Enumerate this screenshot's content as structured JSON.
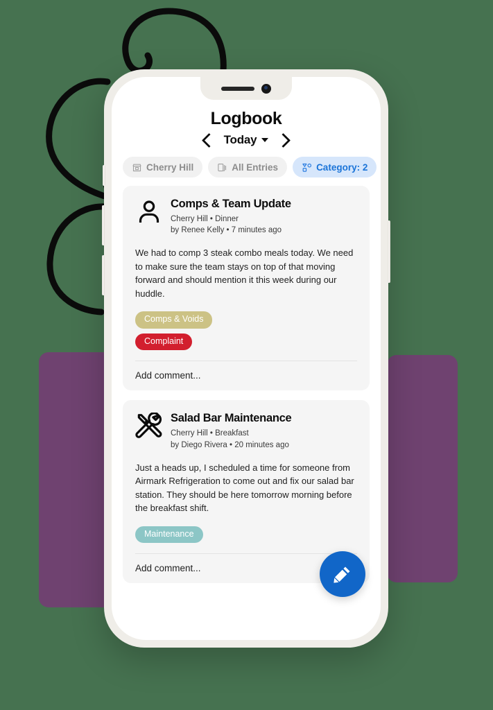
{
  "theme": {
    "background": "#467250",
    "purple_block": "#6F4270",
    "phone_frame": "#EFEDE8",
    "screen": "#FFFFFF",
    "accent_blue": "#1166C8",
    "chip_active_bg": "#D6E6FB",
    "chip_active_text": "#1B74D8",
    "card_bg": "#F5F5F5"
  },
  "app": {
    "title": "Logbook",
    "date_nav": {
      "prev_icon": "chevron-left-icon",
      "label": "Today",
      "caret_icon": "caret-down-icon",
      "next_icon": "chevron-right-icon"
    },
    "filters": [
      {
        "label": "Cherry Hill",
        "icon": "store-icon",
        "active": false
      },
      {
        "label": "All Entries",
        "icon": "documents-icon",
        "active": false
      },
      {
        "label": "Category: 2",
        "icon": "shapes-filter-icon",
        "active": true
      }
    ],
    "entries": [
      {
        "icon": "person-icon",
        "title": "Comps & Team Update",
        "location_shift": "Cherry Hill • Dinner",
        "author_time": "by Renee Kelly • 7 minutes ago",
        "body": "We had to comp 3 steak combo meals today. We need to make sure the team stays on top of that moving forward and should mention it this week during our huddle.",
        "tags": [
          {
            "label": "Comps & Voids",
            "color": "#CCC285"
          },
          {
            "label": "Complaint",
            "color": "#D21F2E"
          }
        ],
        "comment_placeholder": "Add comment..."
      },
      {
        "icon": "tools-icon",
        "title": "Salad Bar Maintenance",
        "location_shift": "Cherry Hill • Breakfast",
        "author_time": "by Diego Rivera • 20 minutes ago",
        "body": "Just a heads up, I scheduled a time for someone from Airmark Refrigeration to come out and fix our salad bar station. They should be here tomorrow morning before the breakfast shift.",
        "tags": [
          {
            "label": "Maintenance",
            "color": "#8CC6C6"
          }
        ],
        "comment_placeholder": "Add comment..."
      }
    ],
    "fab": {
      "icon": "pencil-icon",
      "label": "New entry"
    }
  },
  "device": {
    "notch": {
      "speaker": "speaker-grille",
      "camera": "front-camera"
    },
    "buttons": [
      "silent-switch",
      "volume-up",
      "volume-down",
      "power"
    ]
  }
}
